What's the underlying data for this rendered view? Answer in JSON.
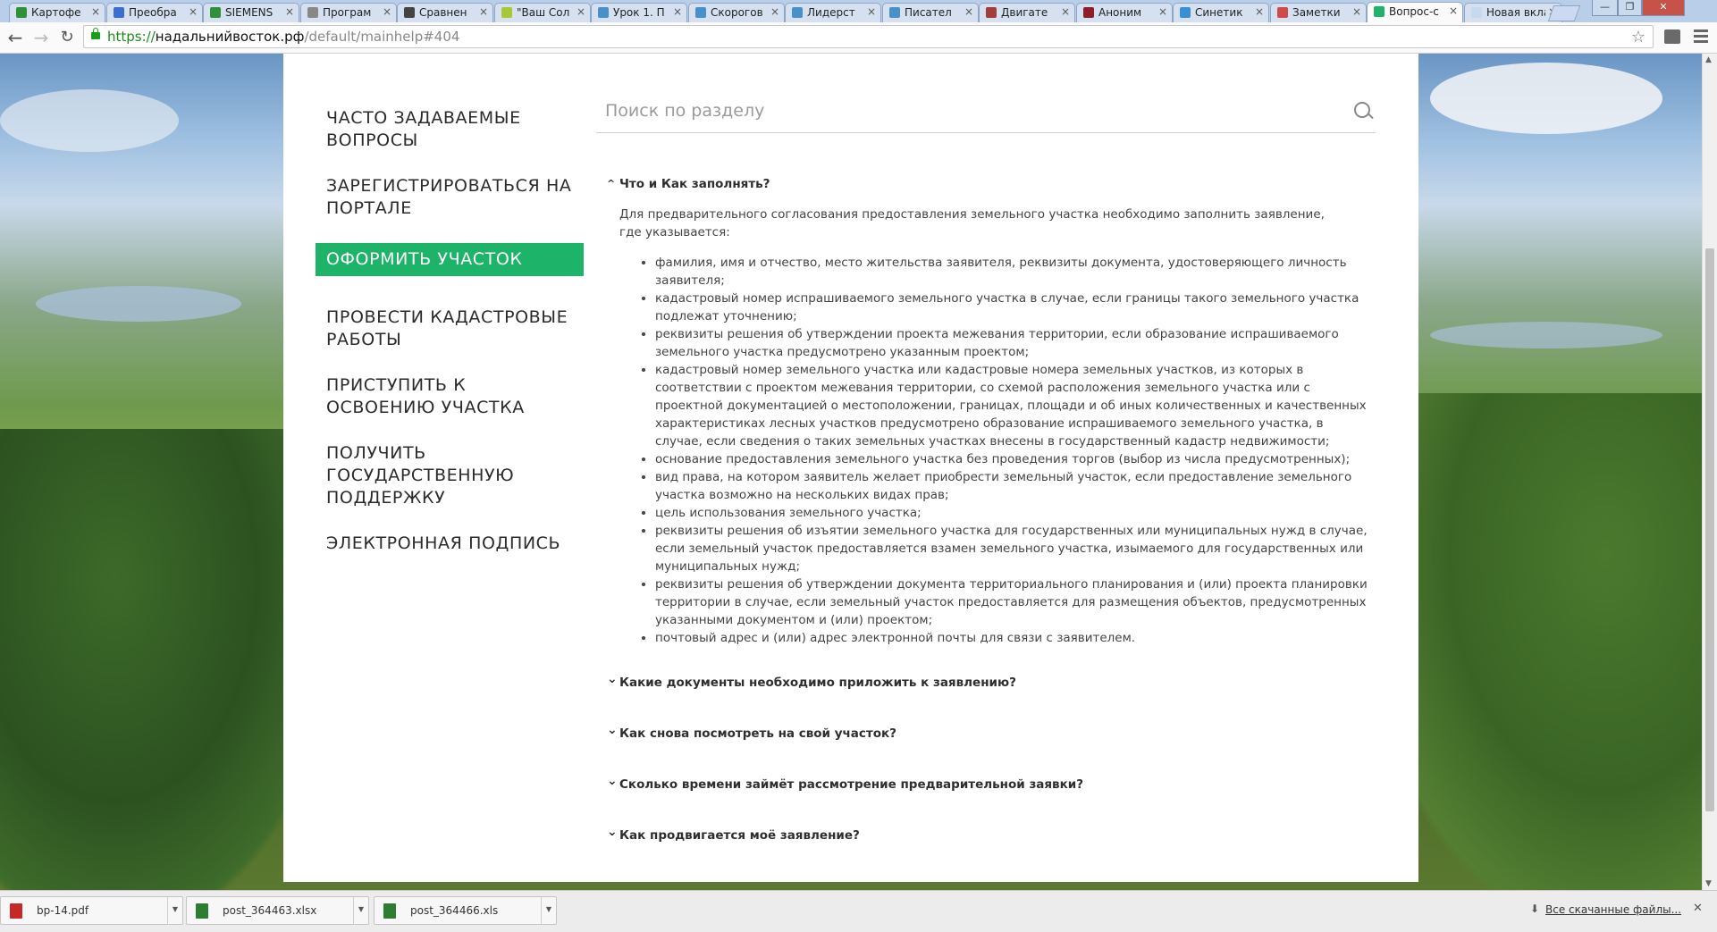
{
  "browser": {
    "tabs": [
      {
        "label": "Картофе",
        "color": "#2f8f3a"
      },
      {
        "label": "Преобра",
        "color": "#3a6fd1"
      },
      {
        "label": "SIEMENS",
        "color": "#2f8f3a"
      },
      {
        "label": "Програм",
        "color": "#888888"
      },
      {
        "label": "Сравнен",
        "color": "#444444"
      },
      {
        "label": "\"Ваш Сол",
        "color": "#a9c934"
      },
      {
        "label": "Урок 1. П",
        "color": "#4a90c8"
      },
      {
        "label": "Скорогов",
        "color": "#4a90c8"
      },
      {
        "label": "Лидерст",
        "color": "#4a90c8"
      },
      {
        "label": "Писател",
        "color": "#4a90c8"
      },
      {
        "label": "Двигате",
        "color": "#a33c3c"
      },
      {
        "label": "Аноним",
        "color": "#8b1f2b"
      },
      {
        "label": "Синетик",
        "color": "#3a8fd1"
      },
      {
        "label": "Заметки",
        "color": "#d14a4a"
      },
      {
        "label": "Вопрос-с",
        "color": "#1db369",
        "active": true
      },
      {
        "label": "Новая вклад",
        "color": "#c8d8ee"
      }
    ],
    "url_scheme": "https://",
    "url_host": "надальнийвосток.рф",
    "url_path": "/default/mainhelp#404"
  },
  "sidebar": {
    "items": [
      {
        "label": "ЧАСТО ЗАДАВАЕМЫЕ ВОПРОСЫ",
        "name": "faq"
      },
      {
        "label": "ЗАРЕГИСТРИРОВАТЬСЯ НА ПОРТАЛЕ",
        "name": "register"
      },
      {
        "label": "ОФОРМИТЬ УЧАСТОК",
        "name": "apply-plot",
        "active": true
      },
      {
        "label": "ПРОВЕСТИ КАДАСТРОВЫЕ РАБОТЫ",
        "name": "cadastral"
      },
      {
        "label": "ПРИСТУПИТЬ К ОСВОЕНИЮ УЧАСТКА",
        "name": "develop"
      },
      {
        "label": "ПОЛУЧИТЬ ГОСУДАРСТВЕННУЮ ПОДДЕРЖКУ",
        "name": "support"
      },
      {
        "label": "ЭЛЕКТРОННАЯ ПОДПИСЬ",
        "name": "esign"
      }
    ],
    "active_color": "#1db369"
  },
  "search": {
    "placeholder": "Поиск по разделу"
  },
  "faq": {
    "open": {
      "question": "Что и Как заполнять?",
      "intro": "Для предварительного согласования предоставления земельного участка необходимо заполнить заявление, где указывается:",
      "items": [
        "фамилия, имя и отчество, место жительства заявителя, реквизиты документа, удостоверяющего личность заявителя;",
        "кадастровый номер испрашиваемого земельного участка в случае, если границы такого земельного участка подлежат уточнению;",
        "реквизиты решения об утверждении проекта межевания территории, если образование испрашиваемого земельного участка предусмотрено указанным проектом;",
        "кадастровый номер земельного участка или кадастровые номера земельных участков, из которых в соответствии с проектом межевания территории, со схемой расположения земельного участка или с проектной документацией о местоположении, границах, площади и об иных количественных и качественных характеристиках лесных участков предусмотрено образование испрашиваемого земельного участка, в случае, если сведения о таких земельных участках внесены в государственный кадастр недвижимости;",
        "основание предоставления земельного участка без проведения торгов (выбор из числа предусмотренных);",
        "вид права, на котором заявитель желает приобрести земельный участок, если предоставление земельного участка возможно на нескольких видах прав;",
        "цель использования земельного участка;",
        "реквизиты решения об изъятии земельного участка для государственных или муниципальных нужд в случае, если земельный участок предоставляется взамен земельного участка, изымаемого для государственных или муниципальных нужд;",
        "реквизиты решения об утверждении документа территориального планирования и (или) проекта планировки территории в случае, если земельный участок предоставляется для размещения объектов, предусмотренных указанными документом и (или) проектом;",
        "почтовый адрес и (или) адрес электронной почты для связи с заявителем."
      ]
    },
    "collapsed": [
      "Какие документы необходимо приложить к заявлению?",
      "Как снова посмотреть на свой участок?",
      "Сколько времени займёт рассмотрение предварительной заявки?",
      "Как продвигается моё заявление?"
    ]
  },
  "downloads": {
    "files": [
      {
        "name": "bp-14.pdf",
        "icon": "pdf-icon",
        "color": "#c62828"
      },
      {
        "name": "post_364463.xlsx",
        "icon": "excel-icon",
        "color": "#2e7d32"
      },
      {
        "name": "post_364466.xls",
        "icon": "excel-icon",
        "color": "#2e7d32"
      }
    ],
    "all_label": "Все скачанные файлы..."
  }
}
